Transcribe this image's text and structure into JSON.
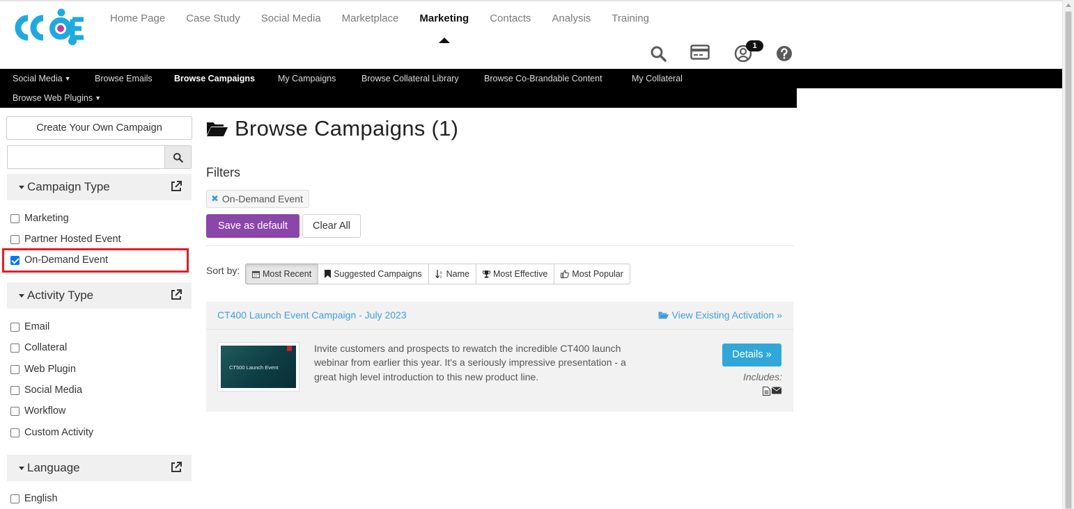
{
  "brand": {
    "logo_text": "CCOE"
  },
  "main_nav": [
    {
      "label": "Home Page",
      "active": false
    },
    {
      "label": "Case Study",
      "active": false
    },
    {
      "label": "Social Media",
      "active": false
    },
    {
      "label": "Marketplace",
      "active": false
    },
    {
      "label": "Marketing",
      "active": true
    },
    {
      "label": "Contacts",
      "active": false
    },
    {
      "label": "Analysis",
      "active": false
    },
    {
      "label": "Training",
      "active": false
    }
  ],
  "header_icons": {
    "notification_count": "1",
    "icons": [
      "search-icon",
      "credit-card-icon",
      "user-icon",
      "help-icon"
    ]
  },
  "sub_nav": {
    "items": [
      {
        "label": "Social Media"
      },
      {
        "label": "Browse Emails"
      },
      {
        "label": "Browse Campaigns",
        "active": true
      },
      {
        "label": "My Campaigns"
      },
      {
        "label": "Browse Collateral Library"
      },
      {
        "label": "Browse Co-Brandable Content"
      },
      {
        "label": "My Collateral"
      },
      {
        "label": "Browse Web Plugins"
      }
    ]
  },
  "sidebar": {
    "create_button": "Create Your Own Campaign",
    "search_placeholder": "",
    "campaign_type": {
      "title": "Campaign Type",
      "options": [
        {
          "label": "Marketing",
          "checked": false
        },
        {
          "label": "Partner Hosted Event",
          "checked": false
        },
        {
          "label": "On-Demand Event",
          "checked": true
        }
      ]
    },
    "activity_type": {
      "title": "Activity Type",
      "options": [
        {
          "label": "Email",
          "checked": false
        },
        {
          "label": "Collateral",
          "checked": false
        },
        {
          "label": "Web Plugin",
          "checked": false
        },
        {
          "label": "Social Media",
          "checked": false
        },
        {
          "label": "Workflow",
          "checked": false
        },
        {
          "label": "Custom Activity",
          "checked": false
        }
      ]
    },
    "language": {
      "title": "Language",
      "options": [
        {
          "label": "English",
          "checked": false
        }
      ]
    }
  },
  "main": {
    "title": "Browse Campaigns (1)",
    "filters_label": "Filters",
    "active_filter": "On-Demand Event",
    "save_default": "Save as default",
    "clear_all": "Clear All",
    "sort_label": "Sort by:",
    "sort_options": [
      "Most Recent",
      "Suggested Campaigns",
      "Name",
      "Most Effective",
      "Most Popular"
    ],
    "campaign": {
      "title": "CT400 Launch Event Campaign - July 2023",
      "view_link": "View Existing Activation »",
      "thumbnail_text": "CT500 Launch Event",
      "description": "Invite customers and prospects to rewatch the incredible CT400 launch webinar from earlier this year.  It's a seriously impressive presentation - a great high level introduction to this new product line.",
      "details_button": "Details »",
      "includes_label": "Includes:"
    }
  },
  "colors": {
    "accent_purple": "#8a46a8",
    "link_blue": "#3e9fd6",
    "details_blue": "#31a7d9",
    "highlight_red": "#e01e26"
  }
}
